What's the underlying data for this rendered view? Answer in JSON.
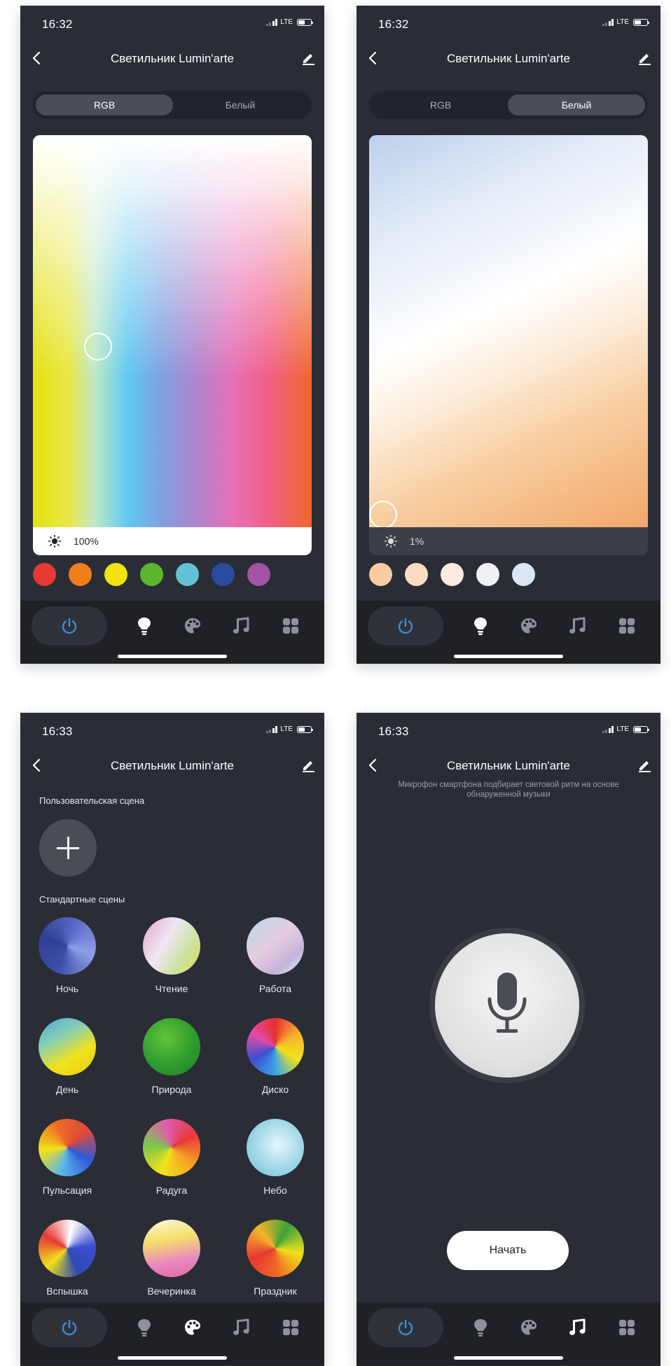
{
  "status": {
    "time_1": "16:32",
    "time_2": "16:33",
    "network": "LTE"
  },
  "header": {
    "title": "Светильник Lumin'arte"
  },
  "mode_toggle": {
    "rgb_label": "RGB",
    "white_label": "Белый"
  },
  "rgb_screen": {
    "brightness": "100%",
    "swatches": [
      "#e53935",
      "#ef7f1a",
      "#f3e20d",
      "#5db52d",
      "#62c3d6",
      "#2a4aa0",
      "#a553a6"
    ]
  },
  "white_screen": {
    "brightness": "1%",
    "swatches": [
      "#f9cba0",
      "#fbdcc0",
      "#fdebe0",
      "#f1f0f6",
      "#dde6f5"
    ]
  },
  "scenes_screen": {
    "custom_title": "Пользовательская сцена",
    "standard_title": "Стандартные сцены",
    "scenes": [
      {
        "name": "Ночь"
      },
      {
        "name": "Чтение"
      },
      {
        "name": "Работа"
      },
      {
        "name": "День"
      },
      {
        "name": "Природа"
      },
      {
        "name": "Диско"
      },
      {
        "name": "Пульсация"
      },
      {
        "name": "Радуга"
      },
      {
        "name": "Небо"
      },
      {
        "name": "Вспышка"
      },
      {
        "name": "Вечеринка"
      },
      {
        "name": "Праздник"
      }
    ]
  },
  "music_screen": {
    "hint": "Микрофон смартфона подбирает световой ритм на основе обнаруженной музыки",
    "start_label": "Начать"
  },
  "colors": {
    "accent": "#3b8fe0",
    "bg": "#2a2d35",
    "tabbar": "#1f2127"
  }
}
